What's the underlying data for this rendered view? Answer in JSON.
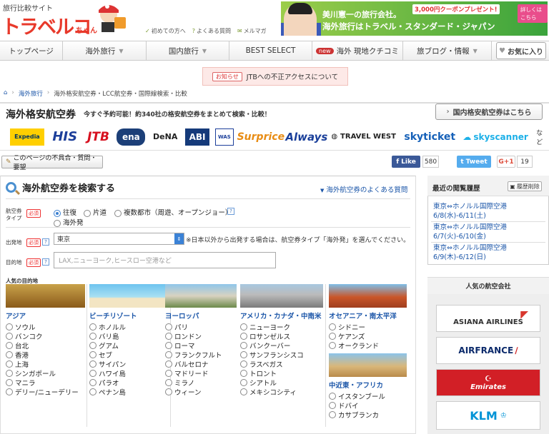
{
  "header": {
    "tagline": "旅行比較サイト",
    "logo_text": "トラベルコ",
    "logo_sub": "ちゃん",
    "links": [
      "初めての方へ",
      "よくある質問",
      "メルマガ"
    ],
    "banner": {
      "line1": "美川憲一の旅行会社。",
      "line2": "海外旅行はトラベル・スタンダード・ジャパン",
      "coupon": "3,000円クーポンプレゼント!",
      "detail": "詳しくはこちら"
    }
  },
  "nav": {
    "items": [
      "トップページ",
      "海外旅行",
      "国内旅行",
      "BEST SELECT",
      "海外 現地クチコミ",
      "旅ブログ・情報"
    ],
    "new_badge": "new",
    "fav": "お気に入り"
  },
  "notice": {
    "tag": "お知らせ",
    "text": "JTBへの不正アクセスについて"
  },
  "breadcrumb": [
    "海外旅行",
    "海外格安航空券・LCC航空券・国際線検索・比較"
  ],
  "page": {
    "title": "海外格安航空券",
    "subtitle": "今すぐ予約可能！約340社の格安航空券をまとめて検索・比較！",
    "domestic_button": "国内格安航空券はこちら"
  },
  "agencies": [
    "Expedia",
    "HIS",
    "JTB",
    "ena",
    "DeNA",
    "ABI",
    "WAS",
    "Surprice",
    "Always",
    "TRAVEL WEST",
    "skyticket",
    "skyscanner"
  ],
  "agencies_etc": "など",
  "feedback": "このページの不具合・質問・要望",
  "social": {
    "like": "Like",
    "like_count": "580",
    "tweet": "Tweet",
    "gplus": "G+1",
    "gplus_count": "19"
  },
  "search": {
    "title": "海外航空券を検索する",
    "faq": "海外航空券のよくある質問",
    "ticket_type_label": "航空券タイプ",
    "required": "必須",
    "ticket_types": [
      "往復",
      "片道",
      "複数都市（周遊、オープンジョー）",
      "海外発"
    ],
    "departure_label": "出発地",
    "departure_value": "東京",
    "departure_note": "※日本以外から出発する場合は、航空券タイプ「海外発」を選んでください。",
    "destination_label": "目的地",
    "destination_placeholder": "LAX,ニューヨーク,ヒースロー空港など",
    "popular_label": "人気の目的地",
    "regions": [
      {
        "name": "アジア",
        "cities": [
          "ソウル",
          "バンコク",
          "台北",
          "香港",
          "上海",
          "シンガポール",
          "マニラ",
          "デリー/ニューデリー"
        ]
      },
      {
        "name": "ビーチリゾート",
        "cities": [
          "ホノルル",
          "バリ島",
          "グアム",
          "セブ",
          "サイパン",
          "ハワイ島",
          "パラオ",
          "ペナン島"
        ]
      },
      {
        "name": "ヨーロッパ",
        "cities": [
          "パリ",
          "ロンドン",
          "ローマ",
          "フランクフルト",
          "バルセロナ",
          "マドリード",
          "ミラノ",
          "ウィーン"
        ]
      },
      {
        "name": "アメリカ・カナダ・中南米",
        "cities": [
          "ニューヨーク",
          "ロサンゼルス",
          "バンクーバー",
          "サンフランシスコ",
          "ラスベガス",
          "トロント",
          "シアトル",
          "メキシコシティ"
        ]
      },
      {
        "name": "オセアニア・南太平洋",
        "cities": [
          "シドニー",
          "ケアンズ",
          "オークランド"
        ]
      },
      {
        "name": "中近東・アフリカ",
        "cities": [
          "イスタンブール",
          "ドバイ",
          "カサブランカ"
        ]
      }
    ]
  },
  "sidebar": {
    "recent_title": "最近の閲覧履歴",
    "recent_clear": "履歴削除",
    "recent": [
      {
        "route": "東京⇔ホノルル国際空港",
        "dates": "6/8(水)-6/11(土)"
      },
      {
        "route": "東京⇔ホノルル国際空港",
        "dates": "6/7(火)-6/10(金)"
      },
      {
        "route": "東京⇔ホノルル国際空港",
        "dates": "6/9(木)-6/12(日)"
      }
    ],
    "popular_airlines_title": "人気の航空会社",
    "airlines": [
      "ASIANA AIRLINES",
      "AIRFRANCE",
      "Emirates",
      "KLM"
    ]
  },
  "colors": {
    "brand_red": "#e8392b",
    "link_blue": "#1a55a8",
    "banner_green": "#3aa33c"
  }
}
